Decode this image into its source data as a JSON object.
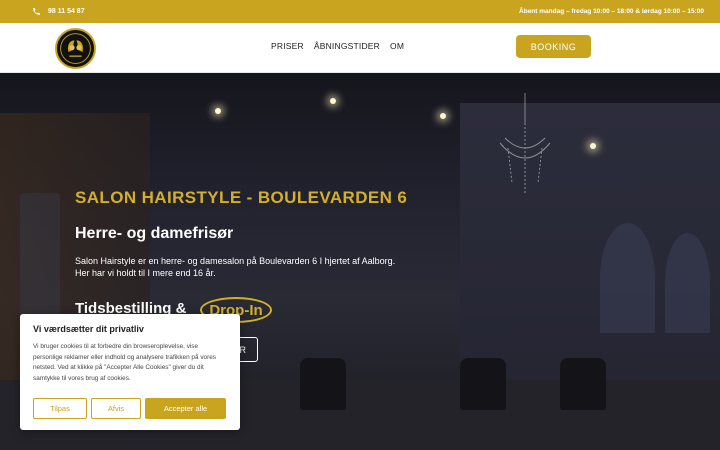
{
  "topbar": {
    "phone": "98 11 54 87",
    "hours": "Åbent mandag – fredag 10:00 – 18:00 & lørdag 10:00 – 15:00"
  },
  "nav": {
    "items": [
      {
        "label": "PRISER"
      },
      {
        "label": "ÅBNINGSTIDER"
      },
      {
        "label": "OM"
      }
    ],
    "booking_label": "BOOKING"
  },
  "hero": {
    "title": "SALON HAIRSTYLE - BOULEVARDEN 6",
    "subtitle": "Herre- og damefrisør",
    "description_line1": "Salon Hairstyle er en herre- og damesalon på Boulevarden 6 I hjertet af Aalborg.",
    "description_line2": "Her har vi holdt til I mere end 16 år.",
    "tidsbestilling": "Tidsbestilling &",
    "dropin": "Drop-In",
    "button_label": "R"
  },
  "cookie": {
    "title": "Vi værdsætter dit privatliv",
    "text": "Vi bruger cookies til at forbedre din browseroplevelse, vise personlige reklamer eller indhold og analysere trafikken på vores netsted. Ved at klikke på \"Accepter Alle Cookies\" giver du dit samtykke til vores brug af cookies.",
    "customize_label": "Tilpas",
    "reject_label": "Afvis",
    "accept_label": "Accepter alle"
  },
  "colors": {
    "accent": "#c9a51f",
    "title_gold": "#d4af2a"
  },
  "icons": {
    "phone": "phone-icon",
    "logo": "salon-logo"
  }
}
